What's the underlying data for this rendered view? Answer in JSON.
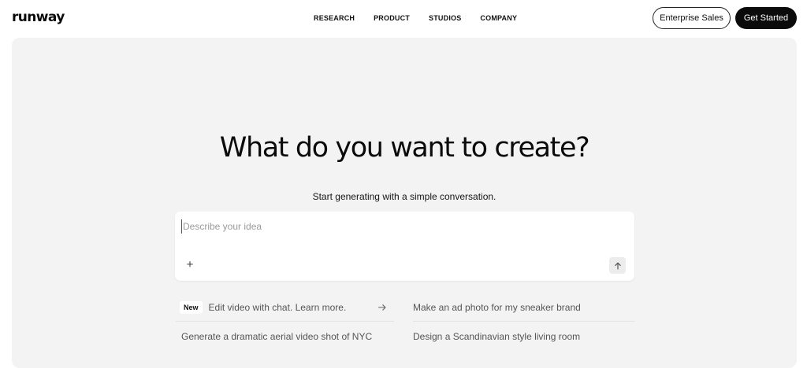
{
  "brand": {
    "logo_text": "runway"
  },
  "nav": {
    "links": [
      "RESEARCH",
      "PRODUCT",
      "STUDIOS",
      "COMPANY"
    ],
    "enterprise_label": "Enterprise Sales",
    "get_started_label": "Get Started"
  },
  "hero": {
    "headline": "What do you want to create?",
    "subline": "Start generating with a simple conversation.",
    "prompt_placeholder": "Describe your idea"
  },
  "suggestions": {
    "badge": "New",
    "items": [
      "Edit video with chat. Learn more.",
      "Make an ad photo for my sneaker brand",
      "Generate a dramatic aerial video shot of NYC",
      "Design a Scandinavian style living room"
    ]
  },
  "icons": {
    "attach": "plus-icon",
    "send": "arrow-up-icon",
    "learn_more": "arrow-right-icon"
  },
  "colors": {
    "hero_bg": "#f3f3f3",
    "primary_button": "#0b0b0b",
    "text": "#111111",
    "muted_text": "#555555",
    "placeholder": "#9a9a9a"
  }
}
